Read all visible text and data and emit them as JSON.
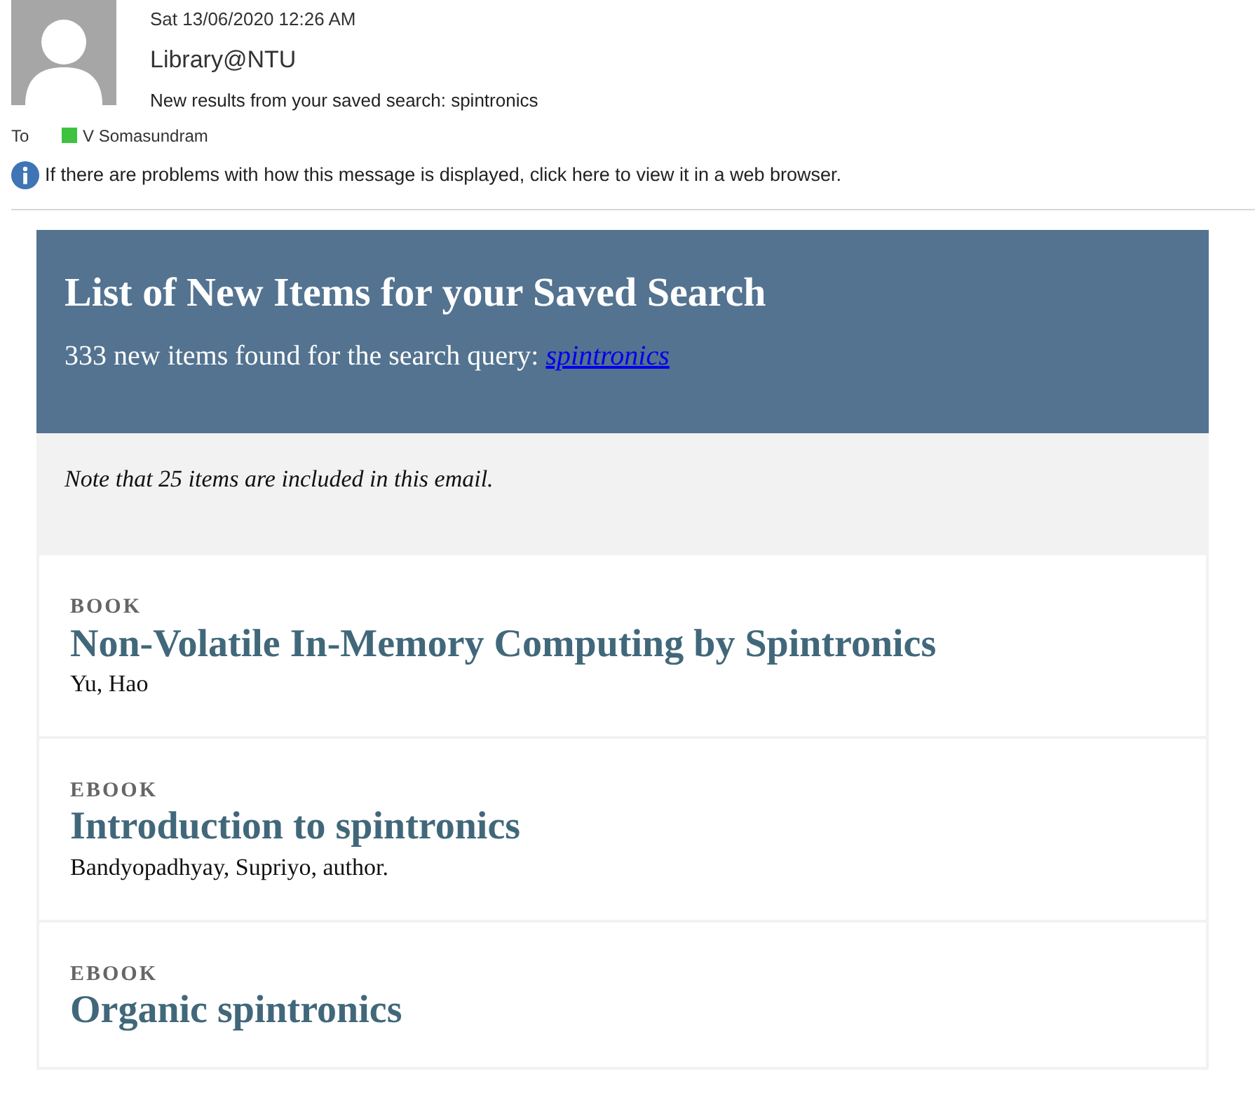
{
  "message": {
    "date": "Sat 13/06/2020 12:26 AM",
    "sender": "Library@NTU",
    "subject": "New results from your saved search: spintronics",
    "to_label": "To",
    "recipient": "V Somasundram",
    "info_bar": "If there are problems with how this message is displayed, click here to view it in a web browser."
  },
  "banner": {
    "title": "List of New Items for your Saved Search",
    "summary": "333 new items found for the search query: ",
    "query": "spintronics"
  },
  "note": "Note that 25 items are included in this email.",
  "items": [
    {
      "type": "BOOK",
      "title": "Non-Volatile In-Memory Computing by Spintronics",
      "author": "Yu, Hao"
    },
    {
      "type": "EBOOK",
      "title": "Introduction to spintronics",
      "author": "Bandyopadhyay, Supriyo, author."
    },
    {
      "type": "EBOOK",
      "title": "Organic spintronics"
    }
  ]
}
